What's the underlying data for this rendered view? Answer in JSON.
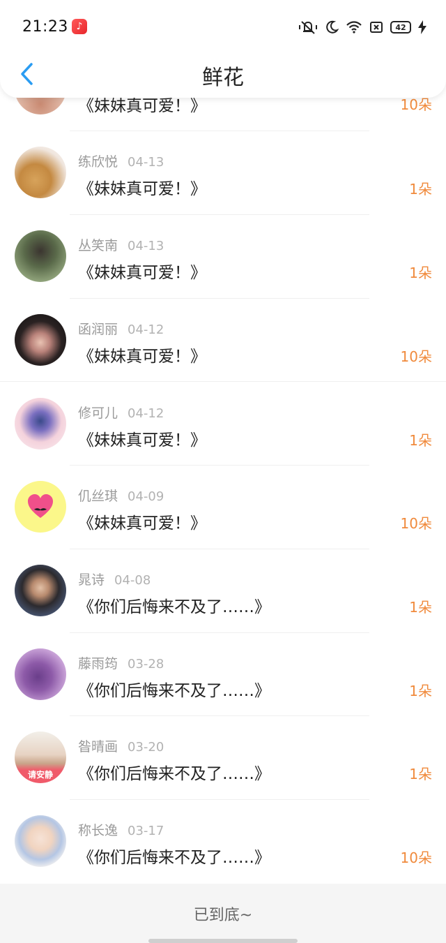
{
  "status_bar": {
    "time": "21:23",
    "battery": "42"
  },
  "nav": {
    "title": "鲜花"
  },
  "items": [
    {
      "name": "",
      "date": "",
      "message": "《妹妹真可爱！》",
      "count": "10朵"
    },
    {
      "name": "练欣悦",
      "date": "04-13",
      "message": "《妹妹真可爱！》",
      "count": "1朵"
    },
    {
      "name": "丛笑南",
      "date": "04-13",
      "message": "《妹妹真可爱！》",
      "count": "1朵"
    },
    {
      "name": "函润丽",
      "date": "04-12",
      "message": "《妹妹真可爱！》",
      "count": "10朵"
    },
    {
      "name": "修可儿",
      "date": "04-12",
      "message": "《妹妹真可爱！》",
      "count": "1朵"
    },
    {
      "name": "仉丝琪",
      "date": "04-09",
      "message": "《妹妹真可爱！》",
      "count": "10朵"
    },
    {
      "name": "晁诗",
      "date": "04-08",
      "message": "《你们后悔来不及了……》",
      "count": "1朵"
    },
    {
      "name": "藤雨筠",
      "date": "03-28",
      "message": "《你们后悔来不及了……》",
      "count": "1朵"
    },
    {
      "name": "昝晴画",
      "date": "03-20",
      "message": "《你们后悔来不及了……》",
      "count": "1朵"
    },
    {
      "name": "称长逸",
      "date": "03-17",
      "message": "《你们后悔来不及了……》",
      "count": "10朵"
    }
  ],
  "footer": {
    "end_text": "已到底~"
  },
  "colors": {
    "accent": "#2a9cf2",
    "count": "#f08a3c"
  },
  "avatar_labels": {
    "badge_text": "请安静"
  }
}
